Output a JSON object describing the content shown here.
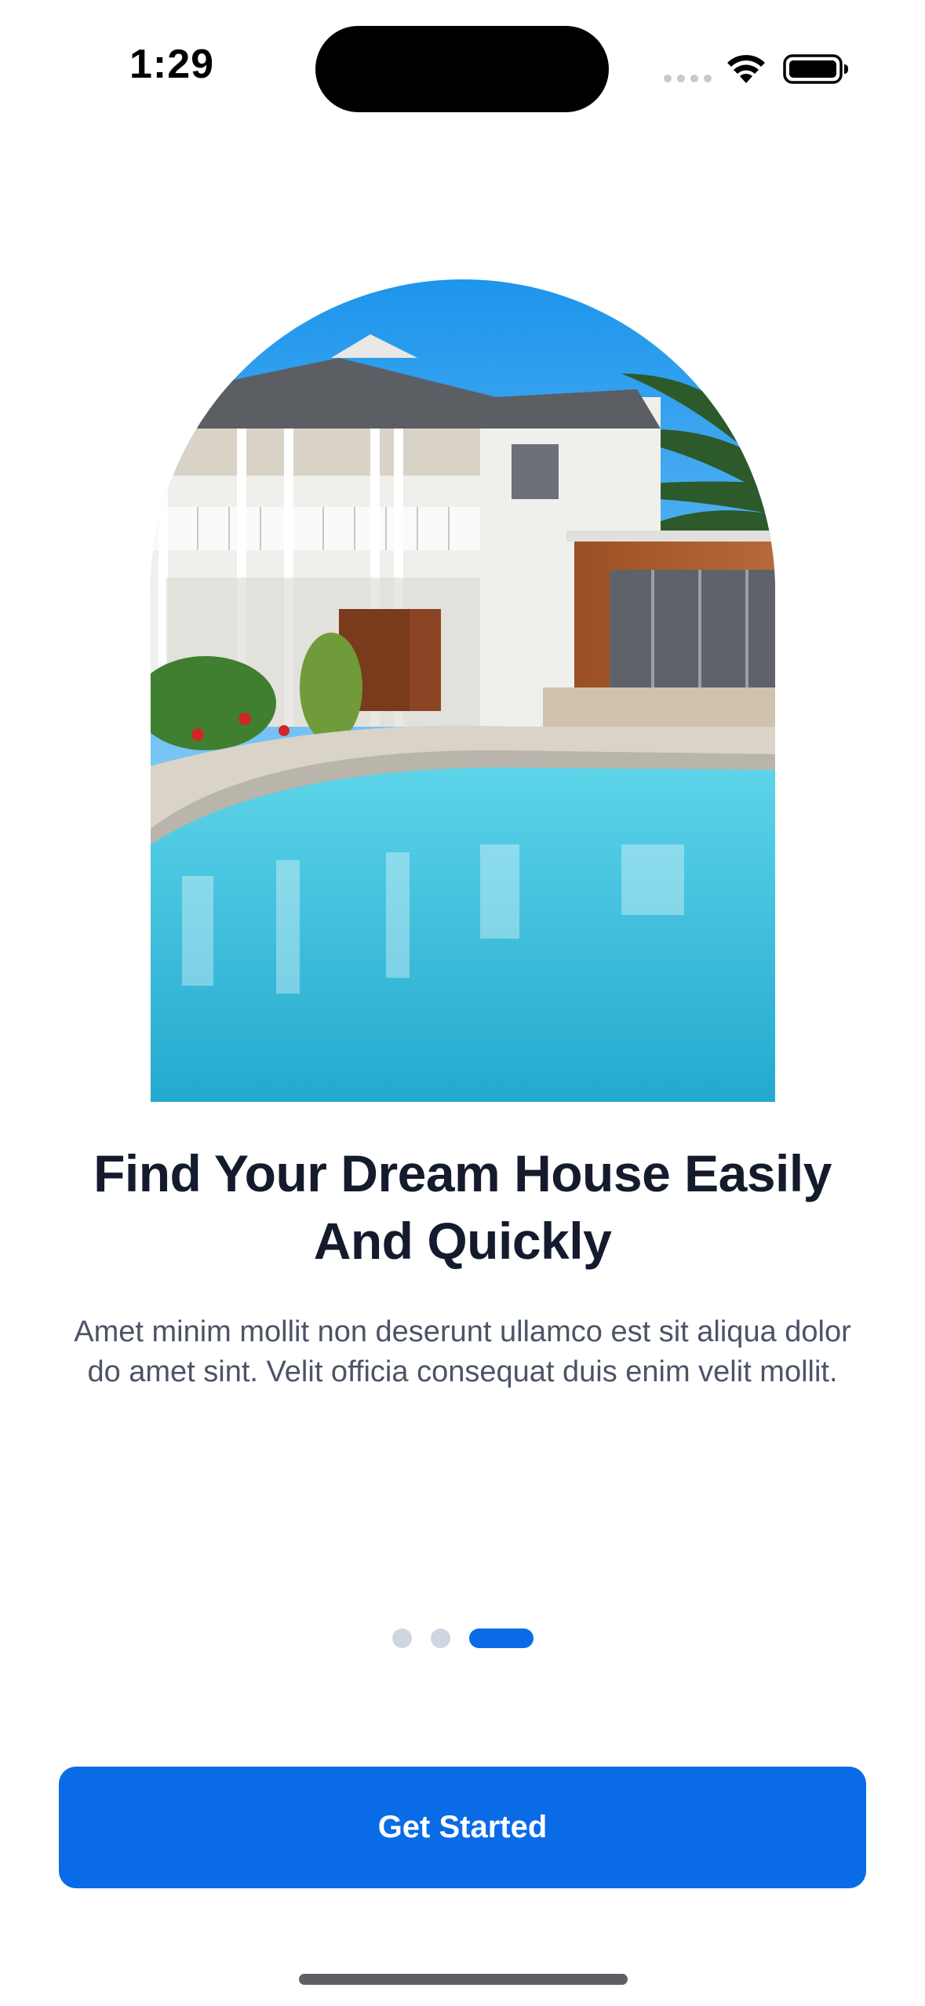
{
  "status_bar": {
    "time": "1:29"
  },
  "hero_image": {
    "icon": "house-with-pool-photo",
    "colors": {
      "sky": "#2a9ef0",
      "pool": "#3fc3e0",
      "wall": "#f2f2f0",
      "cladding": "#a65a2c"
    }
  },
  "onboarding": {
    "title": "Find Your Dream House Easily And Quickly",
    "description": "Amet minim mollit non deserunt ullamco est sit aliqua dolor do amet sint. Velit officia consequat duis enim velit mollit.",
    "page_count": 3,
    "current_page": 3
  },
  "actions": {
    "primary_label": "Get Started"
  },
  "colors": {
    "accent": "#0a6be6",
    "title": "#141b2d",
    "body": "#4b5467",
    "dot_inactive": "#cfd6e2"
  }
}
